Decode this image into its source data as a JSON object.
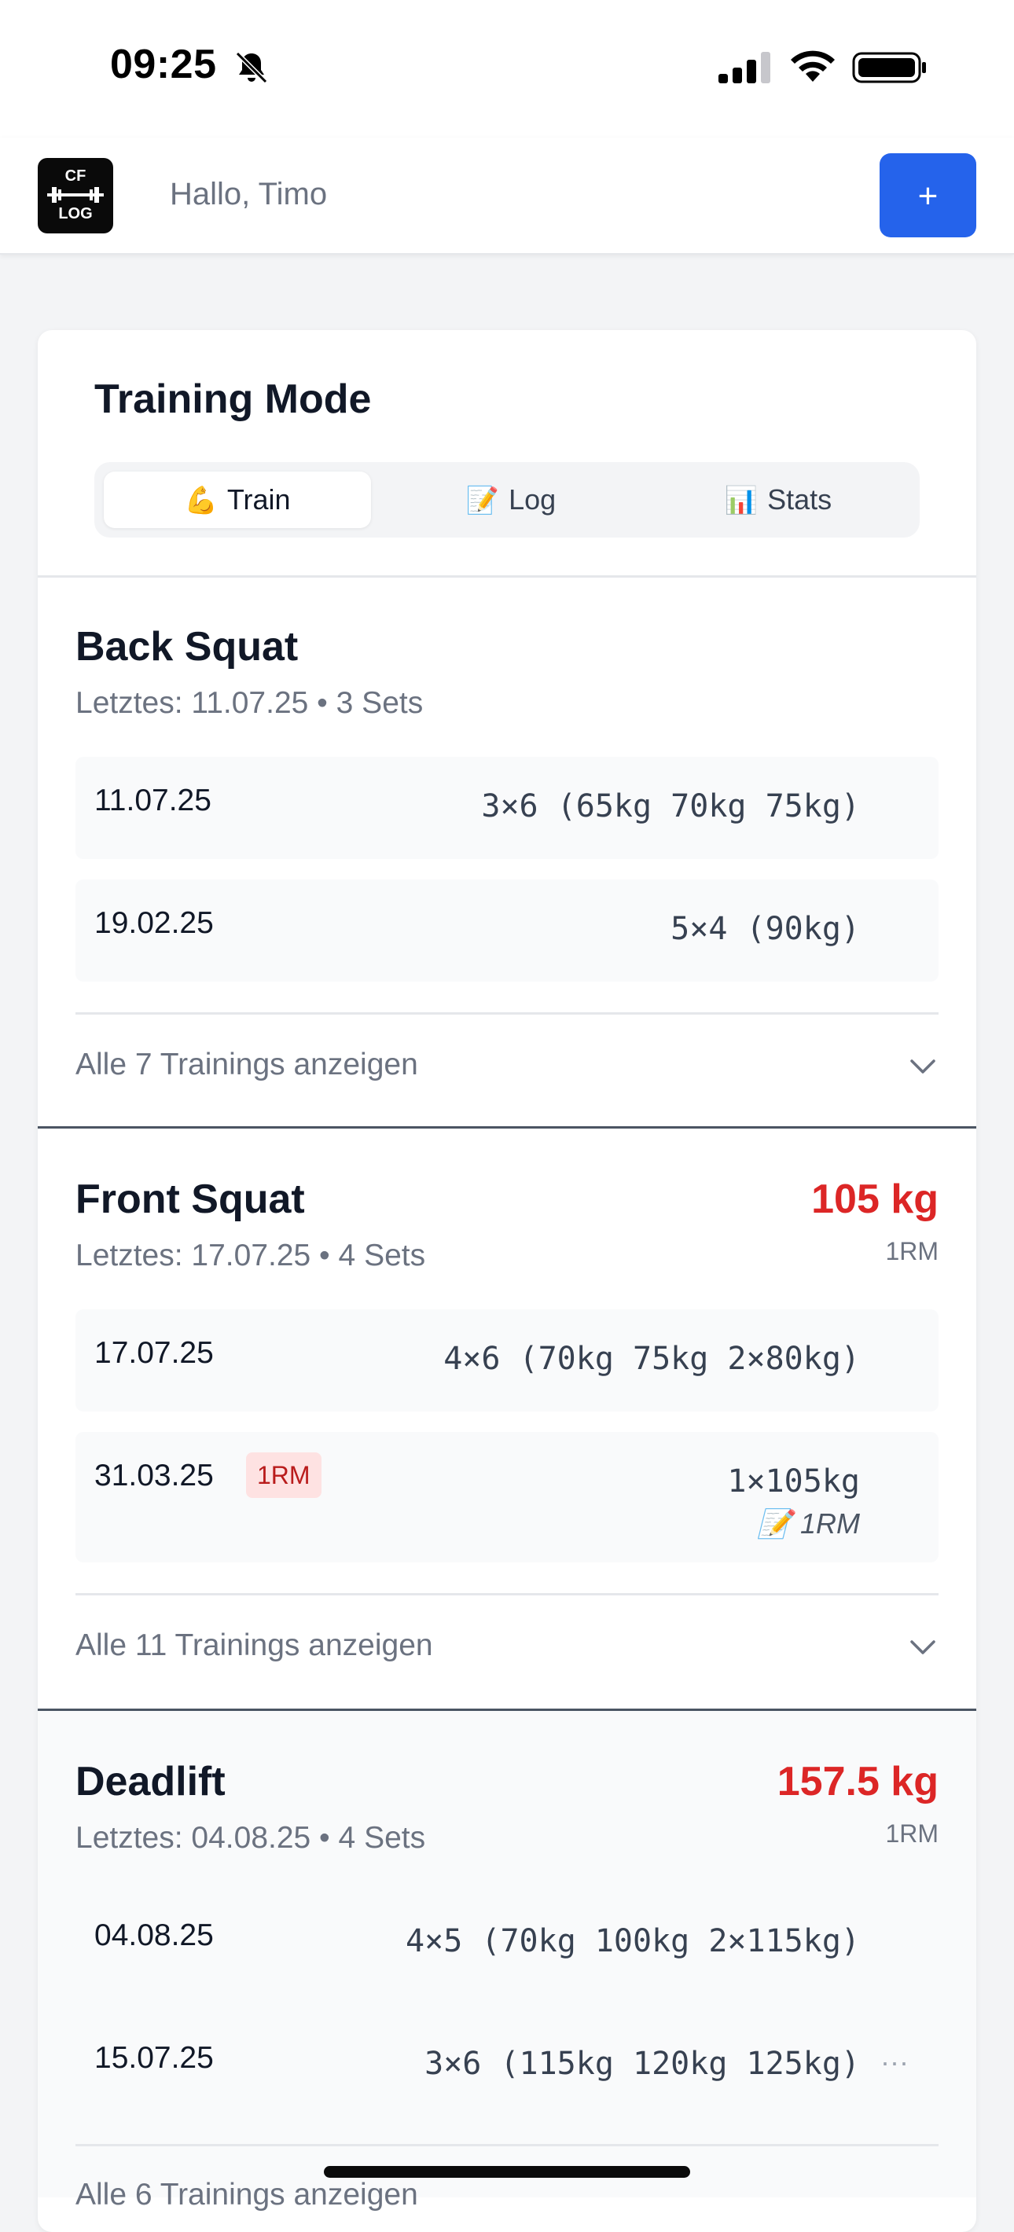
{
  "status_bar": {
    "time": "09:25"
  },
  "header": {
    "logo_top": "CF",
    "logo_bottom": "LOG",
    "greeting": "Hallo, Timo",
    "add_label": "+"
  },
  "card": {
    "title": "Training Mode",
    "tabs": [
      {
        "emoji": "💪",
        "label": "Train",
        "active": true
      },
      {
        "emoji": "📝",
        "label": "Log",
        "active": false
      },
      {
        "emoji": "📊",
        "label": "Stats",
        "active": false
      }
    ]
  },
  "exercises": [
    {
      "name": "Back Squat",
      "subtitle": "Letztes: 11.07.25 • 3 Sets",
      "entries": [
        {
          "date": "11.07.25",
          "sets": "3×6 (65kg 70kg 75kg)"
        },
        {
          "date": "19.02.25",
          "sets": "5×4 (90kg)"
        }
      ],
      "show_all": "Alle 7 Trainings anzeigen"
    },
    {
      "name": "Front Squat",
      "subtitle": "Letztes: 17.07.25 • 4 Sets",
      "rm_value": "105 kg",
      "rm_label": "1RM",
      "entries": [
        {
          "date": "17.07.25",
          "sets": "4×6 (70kg 75kg 2×80kg)"
        },
        {
          "date": "31.03.25",
          "badge": "1RM",
          "sets": "1×105kg",
          "note_emoji": "📝",
          "note": "1RM"
        }
      ],
      "show_all": "Alle 11 Trainings anzeigen"
    },
    {
      "name": "Deadlift",
      "subtitle": "Letztes: 04.08.25 • 4 Sets",
      "rm_value": "157.5 kg",
      "rm_label": "1RM",
      "entries": [
        {
          "date": "04.08.25",
          "sets": "4×5 (70kg 100kg 2×115kg)"
        },
        {
          "date": "15.07.25",
          "sets": "3×6 (115kg 120kg 125kg)",
          "more": "···"
        }
      ],
      "show_all": "Alle 6 Trainings anzeigen"
    }
  ],
  "colors": {
    "accent": "#2563eb",
    "rm": "#dc2626",
    "badge_bg": "#fee2e2"
  }
}
